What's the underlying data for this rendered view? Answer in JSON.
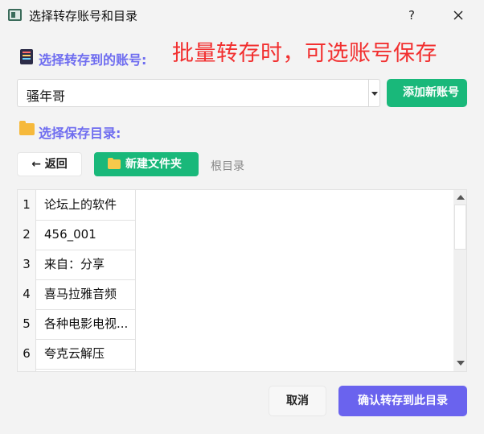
{
  "window": {
    "title": "选择转存账号和目录",
    "help_label": "?"
  },
  "account": {
    "label": "选择转存到的账号:",
    "note": "批量转存时，可选账号保存",
    "selected": "骚年哥",
    "add_button": "添加新账号"
  },
  "folder": {
    "label": "选择保存目录:",
    "back_button": "← 返回",
    "new_folder_button": "新建文件夹",
    "root_link": "根目录",
    "rows": [
      {
        "num": "1",
        "name": "论坛上的软件"
      },
      {
        "num": "2",
        "name": "456_001"
      },
      {
        "num": "3",
        "name": "来自：分享"
      },
      {
        "num": "4",
        "name": "喜马拉雅音频"
      },
      {
        "num": "5",
        "name": "各种电影电视..."
      },
      {
        "num": "6",
        "name": "夸克云解压"
      }
    ]
  },
  "footer": {
    "cancel_button": "取消",
    "confirm_button": "确认转存到此目录"
  },
  "colors": {
    "accent_purple": "#6e6cf0",
    "green": "#19b87a",
    "note_red": "#f23030",
    "confirm_purple": "#6a63ee"
  }
}
